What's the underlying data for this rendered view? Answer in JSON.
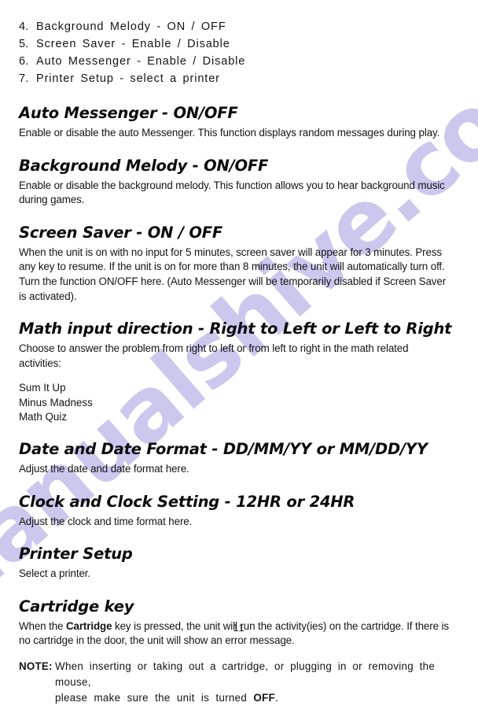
{
  "watermark": {
    "text": "manualshive.com"
  },
  "numbered_list": [
    {
      "num": "4.",
      "text": "Background Melody - ON / OFF"
    },
    {
      "num": "5.",
      "text": "Screen Saver - Enable / Disable"
    },
    {
      "num": "6.",
      "text": "Auto Messenger - Enable / Disable"
    },
    {
      "num": "7.",
      "text": "Printer Setup - select a printer"
    }
  ],
  "sections": {
    "auto_messenger": {
      "heading": "Auto Messenger - ON/OFF",
      "body": "Enable or disable the auto Messenger. This function displays random messages during play."
    },
    "background_melody": {
      "heading": "Background Melody - ON/OFF",
      "body": "Enable or disable the background melody. This function allows you to hear background music during games."
    },
    "screen_saver": {
      "heading": "Screen Saver - ON / OFF",
      "body": "When the unit is on with no input for 5 minutes, screen saver will appear for 3 minutes. Press any key to resume. If the unit is on for more than 8 minutes, the unit will automatically turn off. Turn the function ON/OFF here. (Auto Messenger will be temporarily disabled if Screen Saver is activated)."
    },
    "math_input_direction": {
      "heading": "Math input direction - Right to Left or Left to Right",
      "body": "Choose to answer the problem from right to left or from left to right in the math related activities:",
      "activities": [
        "Sum It Up",
        "Minus Madness",
        "Math Quiz"
      ]
    },
    "date_format": {
      "heading": "Date and Date Format - DD/MM/YY or MM/DD/YY",
      "body": "Adjust the date and date format here."
    },
    "clock_setting": {
      "heading": "Clock and Clock Setting - 12HR or 24HR",
      "body": "Adjust the clock and time format here."
    },
    "printer_setup": {
      "heading": "Printer Setup",
      "body": "Select a printer."
    },
    "cartridge_key": {
      "heading": "Cartridge key",
      "body_before_bold": "When the ",
      "body_bold": "Cartridge",
      "body_after_bold": " key is pressed, the unit will run the activity(ies) on the cartridge.  If there is no cartridge in the door, the unit will show an error message."
    }
  },
  "note": {
    "label": "NOTE:",
    "line1": "When inserting or taking out a cartridge, or plugging in or removing the mouse,",
    "line2_before_bold": "please make sure the unit is turned ",
    "line2_bold": "OFF",
    "line2_after_bold": "."
  },
  "page_number": "11"
}
